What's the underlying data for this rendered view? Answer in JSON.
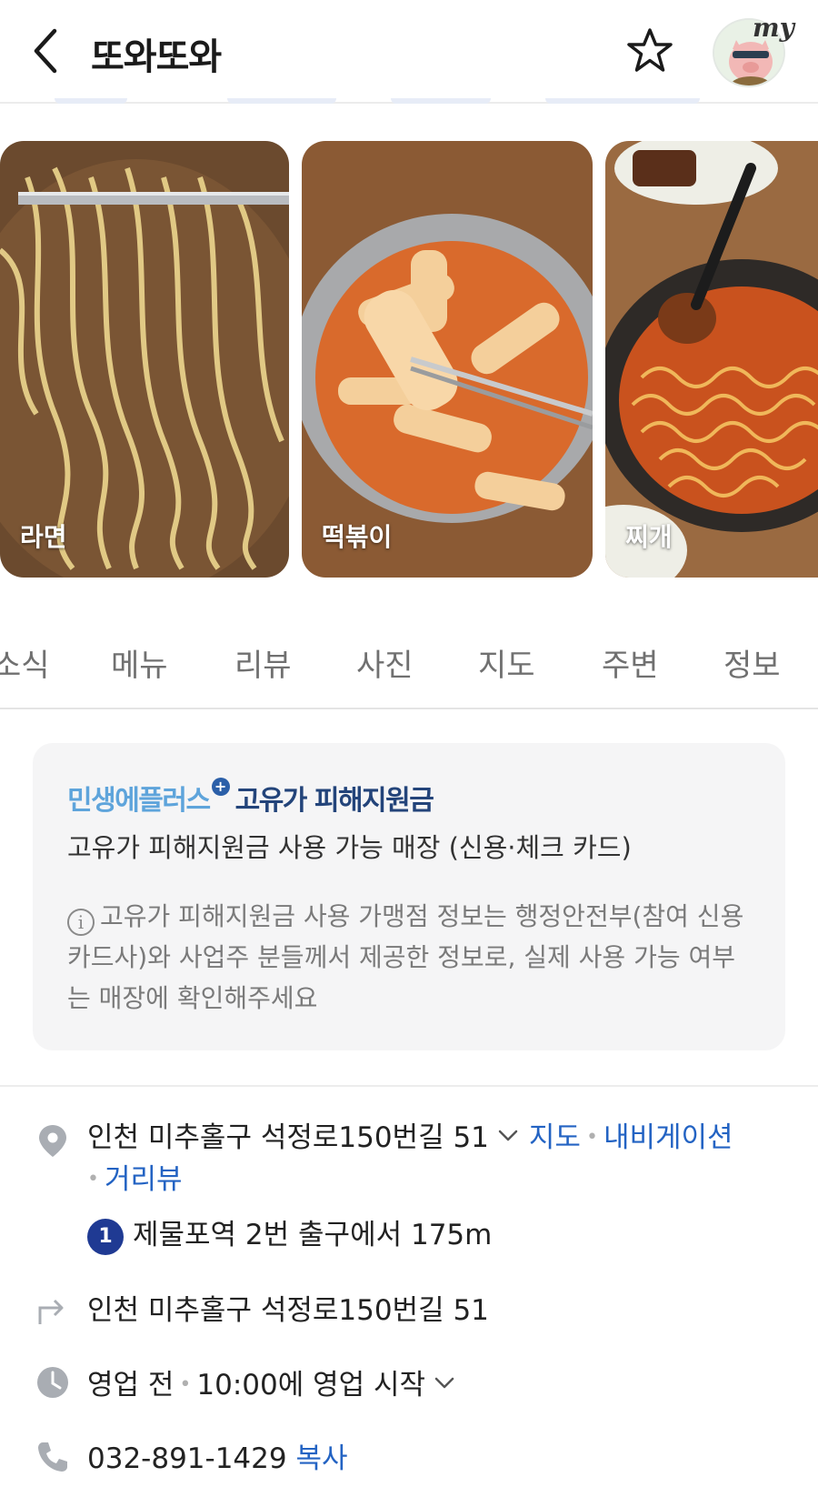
{
  "header": {
    "title": "또와또와",
    "avatar_badge": "my",
    "icons": [
      "chevron-left-icon",
      "star-outline-icon",
      "pig-avatar"
    ]
  },
  "photos": [
    {
      "label": "라면"
    },
    {
      "label": "떡볶이"
    },
    {
      "label": "찌개"
    }
  ],
  "tabs": [
    "소식",
    "메뉴",
    "리뷰",
    "사진",
    "지도",
    "주변",
    "정보"
  ],
  "notice": {
    "badge_part1": "민생에플러스",
    "badge_plus": "+",
    "badge_part2": "고유가 피해지원금",
    "main_text": "고유가 피해지원금 사용 가능 매장 (신용·체크 카드)",
    "info_text": "고유가 피해지원금 사용 가맹점 정보는 행정안전부(참여 신용카드사)와 사업주 분들께서 제공한 정보로, 실제 사용 가능 여부는 매장에 확인해주세요"
  },
  "place": {
    "address": "인천 미추홀구 석정로150번길 51",
    "links": {
      "map": "지도",
      "navigation": "내비게이션",
      "roadview": "거리뷰"
    },
    "subway_line": "1",
    "subway_text": "제물포역 2번 출구에서 175m",
    "jibun_address": "인천 미추홀구 석정로150번길 51",
    "hours_status": "영업 전",
    "hours_detail": "10:00에 영업 시작",
    "phone": "032-891-1429",
    "copy_label": "복사"
  },
  "colors": {
    "link": "#2363c3",
    "subway_line_1": "#1f3a93",
    "badge_light": "#5ea4db",
    "badge_dark": "#23447a"
  }
}
